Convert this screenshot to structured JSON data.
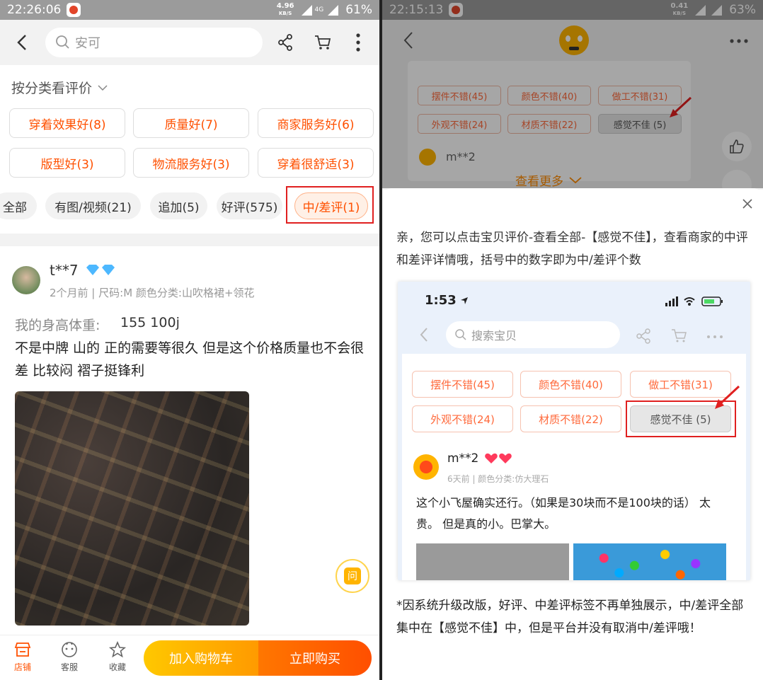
{
  "left": {
    "status": {
      "time": "22:26:06",
      "net_speed": "4.96",
      "net_unit": "KB/S",
      "signal": "4G",
      "battery": "61%"
    },
    "search": {
      "placeholder": "安可"
    },
    "filter_heading": "按分类看评价",
    "categories": [
      "穿着效果好(8)",
      "质量好(7)",
      "商家服务好(6)",
      "版型好(3)",
      "物流服务好(3)",
      "穿着很舒适(3)"
    ],
    "filter_pills": [
      "全部",
      "有图/视频(21)",
      "追加(5)",
      "好评(575)",
      "中/差评(1)"
    ],
    "review": {
      "username": "t**7",
      "meta": "2个月前 | 尺码:M 颜色分类:山吹格裙+领花",
      "height_label": "我的身高体重:",
      "height_value": "155 100j",
      "text": "不是中牌 山的 正的需要等很久 但是这个价格质量也不会很差 比较闷 褶子挺锋利"
    },
    "ask_badge": "问",
    "bottom": {
      "shop": "店铺",
      "service": "客服",
      "favorite": "收藏",
      "add_cart": "加入购物车",
      "buy_now": "立即购买"
    }
  },
  "right": {
    "status": {
      "time": "22:15:13",
      "net_speed": "0.41",
      "net_unit": "KB/S",
      "battery": "63%"
    },
    "bg_tags": [
      "摆件不错(45)",
      "颜色不错(40)",
      "做工不错(31)",
      "外观不错(24)",
      "材质不错(22)",
      "感觉不佳 (5)"
    ],
    "bg_user": "m**2",
    "see_more": "查看更多",
    "message": "亲，您可以点击宝贝评价-查看全部-【感觉不佳】，查看商家的中评和差评详情哦，括号中的数字即为中/差评个数",
    "inner": {
      "time": "1:53",
      "search_placeholder": "搜索宝贝",
      "tags": [
        "摆件不错(45)",
        "颜色不错(40)",
        "做工不错(31)",
        "外观不错(24)",
        "材质不错(22)",
        "感觉不佳 (5)"
      ],
      "user": "m**2",
      "meta": "6天前 | 颜色分类:仿大理石",
      "text": "这个小飞屋确实还行。（如果是30块而不是100块的话） 太贵。 但是真的小。巴掌大。"
    },
    "note": "*因系统升级改版，好评、中差评标签不再单独展示，中/差评全部集中在【感觉不佳】中，但是平台并没有取消中/差评哦！"
  },
  "colors": {
    "accent": "#ff5000",
    "highlight": "#e02020",
    "gold": "#ffb400"
  }
}
